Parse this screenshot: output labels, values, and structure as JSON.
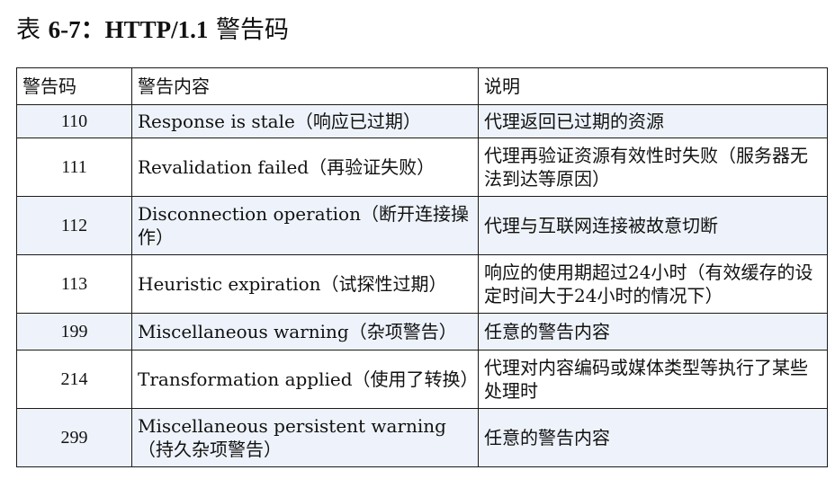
{
  "caption": {
    "prefix": "表 ",
    "number": "6-7：",
    "protocol": "HTTP/1.1",
    "title": " 警告码"
  },
  "table": {
    "headers": [
      "警告码",
      "警告内容",
      "说明"
    ],
    "rows": [
      {
        "code": "110",
        "content": "Response is stale（响应已过期）",
        "description": "代理返回已过期的资源"
      },
      {
        "code": "111",
        "content": "Revalidation failed（再验证失败）",
        "description": "代理再验证资源有效性时失败（服务器无法到达等原因）"
      },
      {
        "code": "112",
        "content": "Disconnection operation（断开连接操作）",
        "description": "代理与互联网连接被故意切断"
      },
      {
        "code": "113",
        "content": "Heuristic expiration（试探性过期）",
        "description": "响应的使用期超过24小时（有效缓存的设定时间大于24小时的情况下）"
      },
      {
        "code": "199",
        "content": "Miscellaneous warning（杂项警告）",
        "description": "任意的警告内容"
      },
      {
        "code": "214",
        "content": "Transformation applied（使用了转换）",
        "description": "代理对内容编码或媒体类型等执行了某些处理时"
      },
      {
        "code": "299",
        "content": "Miscellaneous persistent warning（持久杂项警告）",
        "description": "任意的警告内容"
      }
    ]
  }
}
